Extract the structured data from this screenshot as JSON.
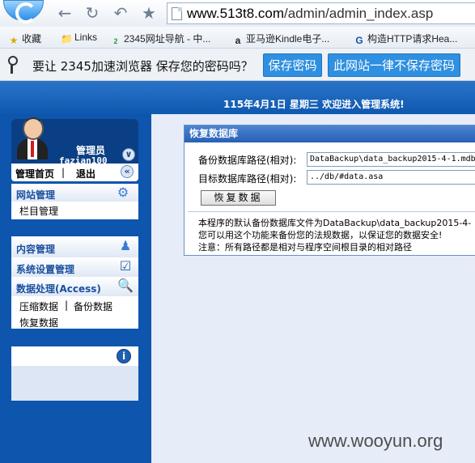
{
  "browser": {
    "url_host": "www.513t8.com",
    "url_path": "/admin/admin_index.asp",
    "bookmarks": [
      {
        "icon": "star-icon",
        "label": "收藏"
      },
      {
        "icon": "folder-icon",
        "label": "Links"
      },
      {
        "icon": "2345-icon",
        "label": "2345网址导航 - 中..."
      },
      {
        "icon": "amazon-icon",
        "label": "亚马逊Kindle电子..."
      },
      {
        "icon": "http-icon",
        "label": "构造HTTP请求Hea..."
      }
    ],
    "password_bar": {
      "message": "要让 2345加速浏览器 保存您的密码吗？",
      "save_label": "保存密码",
      "never_label": "此网站一律不保存密码"
    }
  },
  "header": {
    "welcome": "115年4月1日 星期三 欢迎进入管理系统!"
  },
  "sidebar": {
    "user": {
      "role": "管理员",
      "name": "fazian100",
      "home_link": "管理首页",
      "logout_link": "退出"
    },
    "site_manage": {
      "title": "网站管理",
      "items": [
        "栏目管理"
      ]
    },
    "content_manage": {
      "title": "内容管理"
    },
    "system_settings": {
      "title": "系统设置管理"
    },
    "data_process": {
      "title": "数据处理(Access)",
      "items": [
        "压缩数据",
        "|",
        "备份数据",
        "恢复数据"
      ]
    }
  },
  "restore": {
    "title": "恢复数据库",
    "backup_label": "备份数据库路径(相对):",
    "backup_value": "DataBackup\\data_backup2015-4-1.mdb",
    "target_label": "目标数据库路径(相对):",
    "target_value": "../db/#data.asa",
    "button": "恢复数据",
    "info": [
      "本程序的默认备份数据库文件为DataBackup\\data_backup2015-4-",
      "您可以用这个功能来备份您的法规数据，以保证您的数据安全!",
      "注意：所有路径都是相对与程序空间根目录的相对路径"
    ]
  },
  "watermark": "www.wooyun.org",
  "colors": {
    "sidebar_bg": "#0d55ad",
    "header_bg": "#1a63bb",
    "content_bg": "#e6ecf8",
    "card_header": "#3a74c8",
    "button_blue": "#2f8fe0"
  }
}
